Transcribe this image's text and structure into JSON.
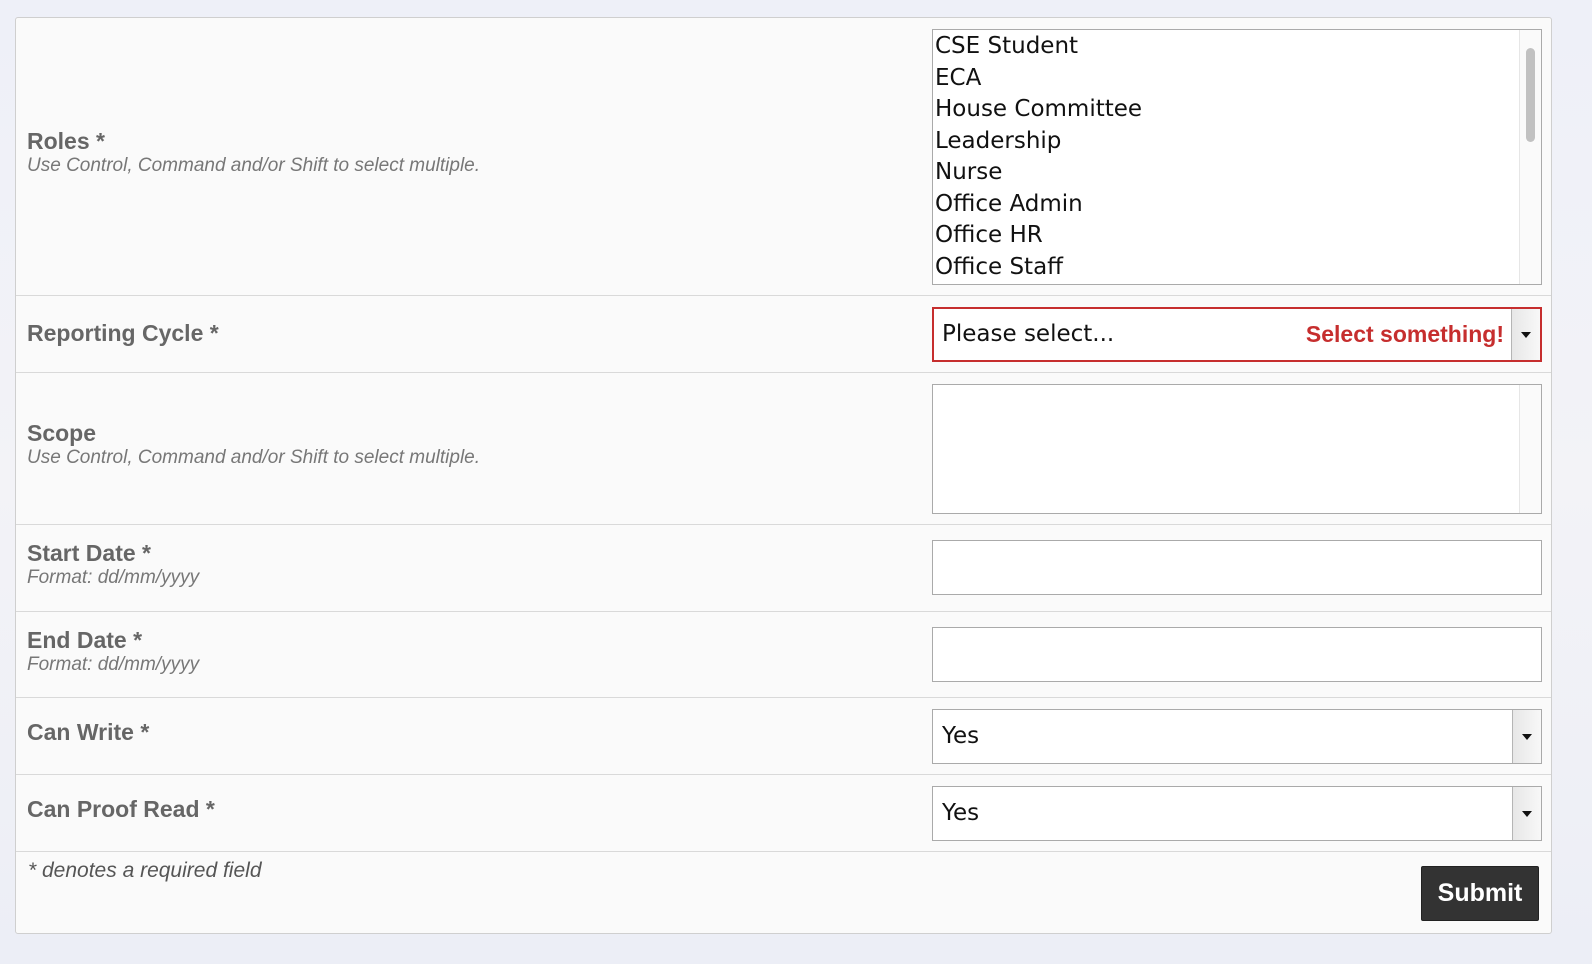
{
  "form": {
    "roles": {
      "label": "Roles *",
      "hint": "Use Control, Command and/or Shift to select multiple.",
      "options": [
        "CSE Student",
        "ECA",
        "House Committee",
        "Leadership",
        "Nurse",
        "Office Admin",
        "Office HR",
        "Office Staff"
      ]
    },
    "reporting_cycle": {
      "label": "Reporting Cycle *",
      "value": "Please select...",
      "error": "Select something!"
    },
    "scope": {
      "label": "Scope",
      "hint": "Use Control, Command and/or Shift to select multiple."
    },
    "start_date": {
      "label": "Start Date *",
      "hint": "Format: dd/mm/yyyy",
      "value": ""
    },
    "end_date": {
      "label": "End Date *",
      "hint": "Format: dd/mm/yyyy",
      "value": ""
    },
    "can_write": {
      "label": "Can Write *",
      "value": "Yes"
    },
    "can_proof_read": {
      "label": "Can Proof Read *",
      "value": "Yes"
    },
    "required_note": "* denotes a required field",
    "submit_label": "Submit"
  },
  "colors": {
    "error": "#c62e2e",
    "button": "#333333",
    "label": "#666666"
  }
}
